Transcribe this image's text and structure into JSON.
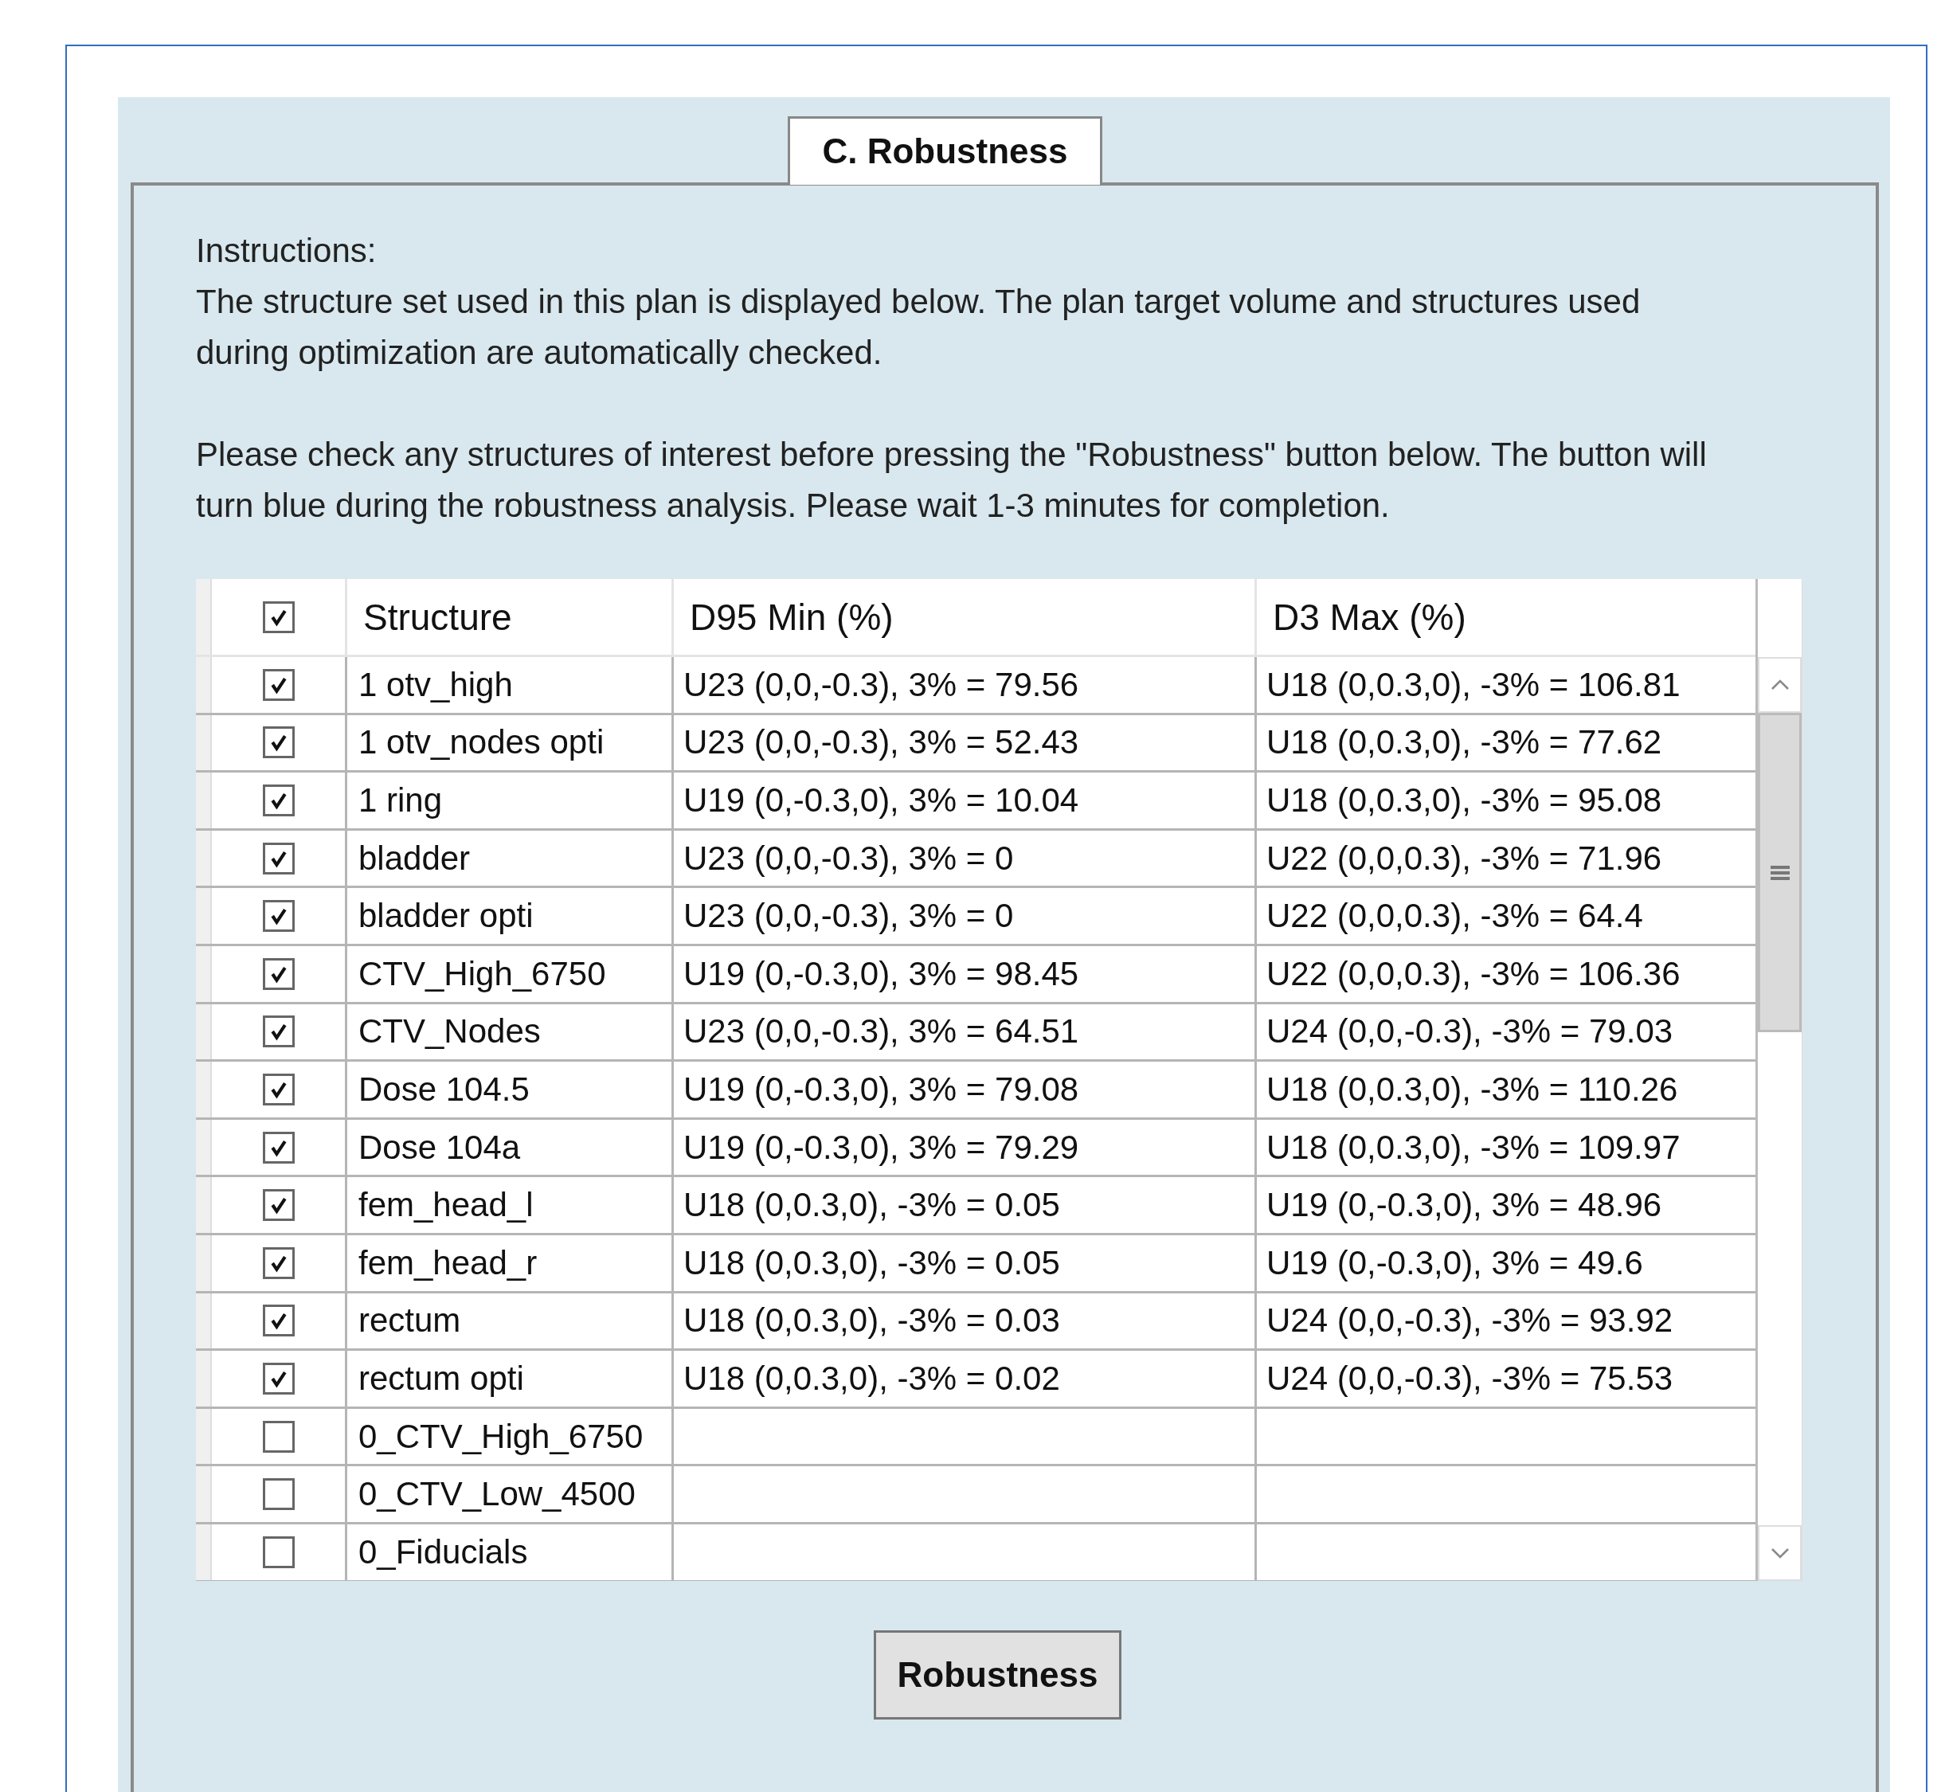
{
  "tab": {
    "label": "C. Robustness",
    "selected": true
  },
  "instructions": {
    "heading": "Instructions:",
    "paragraphs": [
      "The structure set used in this plan is displayed below. The plan target volume and structures used during optimization are automatically checked.",
      "Please check any structures of interest before pressing the \"Robustness\" button below. The button will turn blue during the robustness analysis. Please wait 1-3 minutes for completion."
    ]
  },
  "table": {
    "header_checked": true,
    "columns": [
      "Structure",
      "D95 Min (%)",
      "D3 Max (%)"
    ],
    "rows": [
      {
        "checked": true,
        "structure": "1 otv_high",
        "d95_min": "U23 (0,0,-0.3), 3% = 79.56",
        "d3_max": "U18 (0,0.3,0), -3% = 106.81"
      },
      {
        "checked": true,
        "structure": "1 otv_nodes opti",
        "d95_min": "U23 (0,0,-0.3), 3% = 52.43",
        "d3_max": "U18 (0,0.3,0), -3% = 77.62"
      },
      {
        "checked": true,
        "structure": "1 ring",
        "d95_min": "U19 (0,-0.3,0), 3% = 10.04",
        "d3_max": "U18 (0,0.3,0), -3% = 95.08"
      },
      {
        "checked": true,
        "structure": "bladder",
        "d95_min": "U23 (0,0,-0.3), 3% = 0",
        "d3_max": "U22 (0,0,0.3), -3% = 71.96"
      },
      {
        "checked": true,
        "structure": "bladder opti",
        "d95_min": "U23 (0,0,-0.3), 3% = 0",
        "d3_max": "U22 (0,0,0.3), -3% = 64.4"
      },
      {
        "checked": true,
        "structure": "CTV_High_6750",
        "d95_min": "U19 (0,-0.3,0), 3% = 98.45",
        "d3_max": "U22 (0,0,0.3), -3% = 106.36"
      },
      {
        "checked": true,
        "structure": "CTV_Nodes",
        "d95_min": "U23 (0,0,-0.3), 3% = 64.51",
        "d3_max": "U24 (0,0,-0.3), -3% = 79.03"
      },
      {
        "checked": true,
        "structure": "Dose 104.5",
        "d95_min": "U19 (0,-0.3,0), 3% = 79.08",
        "d3_max": "U18 (0,0.3,0), -3% = 110.26"
      },
      {
        "checked": true,
        "structure": "Dose 104a",
        "d95_min": "U19 (0,-0.3,0), 3% = 79.29",
        "d3_max": "U18 (0,0.3,0), -3% = 109.97"
      },
      {
        "checked": true,
        "structure": "fem_head_l",
        "d95_min": "U18 (0,0.3,0), -3% = 0.05",
        "d3_max": "U19 (0,-0.3,0), 3% = 48.96"
      },
      {
        "checked": true,
        "structure": "fem_head_r",
        "d95_min": "U18 (0,0.3,0), -3% = 0.05",
        "d3_max": "U19 (0,-0.3,0), 3% = 49.6"
      },
      {
        "checked": true,
        "structure": "rectum",
        "d95_min": "U18 (0,0.3,0), -3% = 0.03",
        "d3_max": "U24 (0,0,-0.3), -3% = 93.92"
      },
      {
        "checked": true,
        "structure": "rectum opti",
        "d95_min": "U18 (0,0.3,0), -3% = 0.02",
        "d3_max": "U24 (0,0,-0.3), -3% = 75.53"
      },
      {
        "checked": false,
        "structure": "0_CTV_High_6750"
      },
      {
        "checked": false,
        "structure": "0_CTV_Low_4500"
      },
      {
        "checked": false,
        "structure": "0_Fiducials"
      }
    ]
  },
  "button": {
    "label": "Robustness"
  }
}
